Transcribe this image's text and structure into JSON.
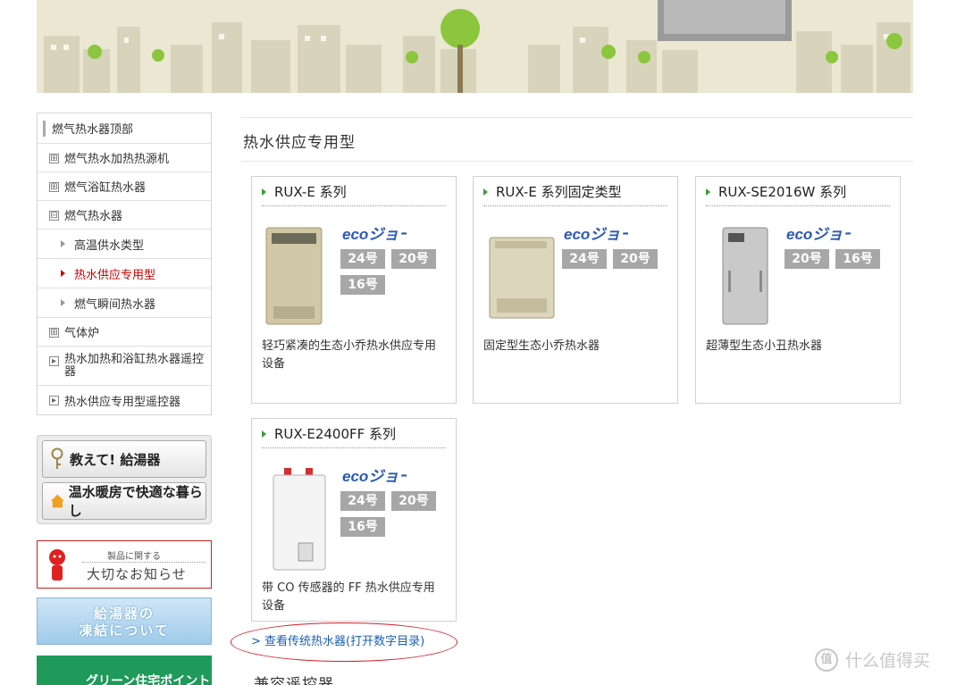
{
  "sidebar": {
    "items": [
      {
        "label": "燃气热水器顶部"
      },
      {
        "label": "燃气热水加热热源机",
        "marker": "⊞"
      },
      {
        "label": "燃气浴缸热水器",
        "marker": "⊞"
      },
      {
        "label": "燃气热水器",
        "marker": "⊟"
      },
      {
        "label": "高温供水类型"
      },
      {
        "label": "热水供应专用型"
      },
      {
        "label": "燃气瞬间热水器"
      },
      {
        "label": "气体炉",
        "marker": "⊞"
      },
      {
        "label": "热水加热和浴缸热水器遥控器",
        "marker": "▸"
      },
      {
        "label": "热水供应专用型遥控器",
        "marker": "▸"
      }
    ],
    "banners": {
      "teach_label": "教えて! 給湯器",
      "warm_label": "温水暖房で快適な暮らし",
      "notice_small": "製品に関する",
      "notice_big": "大切なお知らせ",
      "freeze_line1": "給湯器の",
      "freeze_line2": "凍結について",
      "green_label": "グリーン住宅ポイント"
    }
  },
  "main": {
    "title": "热水供应专用型",
    "eco_logo_text": "ecoジョーズ",
    "cards": [
      {
        "name": "RUX-E 系列",
        "badges": [
          "24号",
          "20号",
          "16号"
        ],
        "desc": "轻巧紧凑的生态小乔热水供应专用设备"
      },
      {
        "name": "RUX-E 系列固定类型",
        "badges": [
          "24号",
          "20号"
        ],
        "desc": "固定型生态小乔热水器"
      },
      {
        "name": "RUX-SE2016W 系列",
        "badges": [
          "20号",
          "16号"
        ],
        "desc": "超薄型生态小丑热水器"
      },
      {
        "name": "RUX-E2400FF 系列",
        "badges": [
          "24号",
          "20号",
          "16号"
        ],
        "desc": "带 CO 传感器的 FF 热水供应专用设备"
      }
    ],
    "catalog_link": "> 查看传统热水器(打开数字目录)",
    "compat_title": "兼容遥控器"
  },
  "watermark": {
    "icon_text": "值",
    "label": "什么值得买"
  },
  "colors": {
    "active_nav": "#cc0000",
    "badge_gray": "#a7a7a7",
    "link_blue": "#1a5fb4",
    "annotation_red": "#d0202a",
    "eco_blue": "#2a5ab8"
  }
}
